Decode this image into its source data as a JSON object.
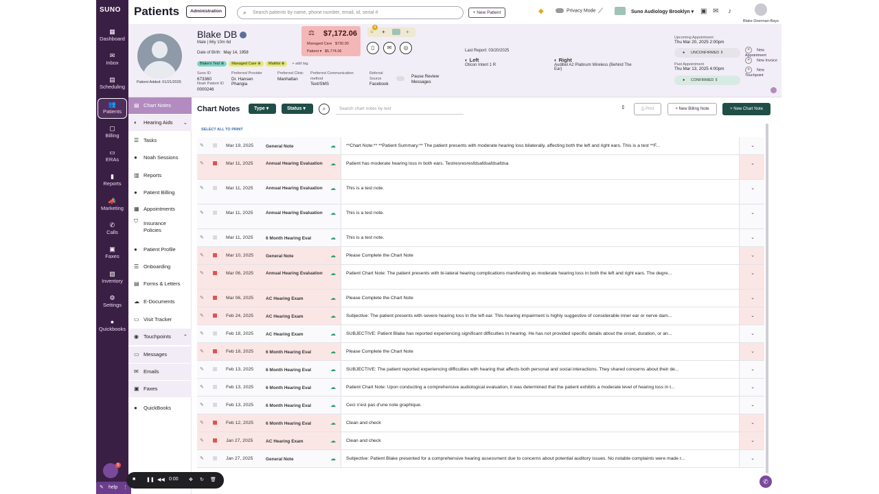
{
  "nav": {
    "brand": "SUNO",
    "items": [
      {
        "icon": "▦",
        "label": "Dashboard"
      },
      {
        "icon": "✉",
        "label": "Inbox"
      },
      {
        "icon": "▤",
        "label": "Scheduling"
      },
      {
        "icon": "👥",
        "label": "Patients"
      },
      {
        "icon": "▢",
        "label": "Billing"
      },
      {
        "icon": "▭",
        "label": "ERAs"
      },
      {
        "icon": "▮",
        "label": "Reports"
      },
      {
        "icon": "📣",
        "label": "Marketing"
      },
      {
        "icon": "✆",
        "label": "Calls"
      },
      {
        "icon": "▣",
        "label": "Faxes"
      },
      {
        "icon": "▧",
        "label": "Inventory"
      },
      {
        "icon": "⚙",
        "label": "Settings"
      },
      {
        "icon": "●",
        "label": "Quickbooks"
      }
    ]
  },
  "topbar": {
    "title": "Patients",
    "admin_label": "Administration",
    "search_placeholder": "Search patients by name, phone number, email, id, serial #",
    "new_patient_label": "+ New Patient",
    "privacy_label": "Privacy Mode",
    "clinic_label": "Suno Audiology Brooklyn",
    "user_name": "Blake Doerman-Bays"
  },
  "patient": {
    "name": "Blake DB",
    "sub": "Male | 66y 10m 6d",
    "dob_label": "Date of Birth:",
    "dob": "May 14, 1958",
    "added": "Patient Added: 01/21/2025",
    "tags": [
      {
        "label": "Blake's Test",
        "color": "#7fd6c4"
      },
      {
        "label": "Managed Care",
        "color": "#e5e86e"
      },
      {
        "label": "Waitlist",
        "color": "#e5e86e"
      }
    ],
    "add_tag": "+ add tag",
    "suno_id_label": "Suno ID",
    "suno_id": "673360",
    "noah_id_label": "Noah Patient ID",
    "noah_id": "0000246",
    "provider_label": "Preferred Provider",
    "provider": "Dr. Hansen Phangia",
    "clinic_label": "Preferred Clinic",
    "clinic": "Manhattan",
    "comm_label": "Preferred Communication method",
    "comm": "Text/SMS",
    "referral_label": "Referral Source",
    "referral": "Facebook",
    "pause_label": "Pause Review Messages",
    "balance_total": "$7,172.06",
    "managed_care_label": "Managed Care",
    "managed_care_amt": "$730.00",
    "patient_label": "Patient",
    "patient_amt": "$5,774.06",
    "quick_badge": "4",
    "last_report": "Last Report: 03/20/2025",
    "left_label": "Left",
    "left_device": "Oticon Intent 1 R",
    "right_label": "Right",
    "right_device": "Audibel A2 Platinum Wireless (Behind The Ear)",
    "upcoming_label": "Upcoming Appointment",
    "upcoming": "Thu Mar 20, 2025 2:00pm",
    "upcoming_status": "UNCONFIRMED",
    "past_label": "Past Appointment",
    "past": "Thu Mar 13, 2025 4:00pm",
    "past_status": "CONFIRMED",
    "new_appt": "New Appointment",
    "new_invoice": "New Invoice",
    "new_touchpoint": "New Touchpoint"
  },
  "subnav": [
    {
      "icon": "▤",
      "label": "Chart Notes",
      "state": "active"
    },
    {
      "icon": "◐",
      "label": "Hearing Aids",
      "state": "grp",
      "chev": "⌄"
    },
    {
      "icon": "☰",
      "label": "Tasks"
    },
    {
      "icon": "●",
      "label": "Noah Sessions"
    },
    {
      "icon": "▥",
      "label": "Reports"
    },
    {
      "icon": "●",
      "label": "Patient Billing"
    },
    {
      "icon": "▦",
      "label": "Appointments"
    },
    {
      "icon": "⛉",
      "label": "Insurance Policies",
      "two": true
    },
    {
      "icon": "●",
      "label": "Patient Profile"
    },
    {
      "icon": "☰",
      "label": "Onboarding"
    },
    {
      "icon": "▤",
      "label": "Forms & Letters"
    },
    {
      "icon": "☁",
      "label": "E-Documents"
    },
    {
      "icon": "▭",
      "label": "Visit Tracker"
    },
    {
      "icon": "◉",
      "label": "Touchpoints",
      "state": "grp",
      "chev": "⌃"
    },
    {
      "icon": "▭",
      "label": "Messages",
      "state": "grp"
    },
    {
      "icon": "✉",
      "label": "Emails",
      "state": "grp"
    },
    {
      "icon": "▣",
      "label": "Faxes",
      "state": "grp"
    },
    {
      "icon": "●",
      "label": "QuickBooks"
    }
  ],
  "chart_notes": {
    "title": "Chart Notes",
    "type_label": "Type",
    "status_label": "Status",
    "search_placeholder": "Search chart notes by text",
    "print_label": "Print",
    "new_billing_label": "+ New Billing Note",
    "new_chart_label": "+ New Chart Note",
    "select_all": "SELECT ALL TO PRINT",
    "rows": [
      {
        "date": "Mar 19, 2025",
        "type": "General Note",
        "flag": false,
        "tall": false,
        "note": "**Chart Note:** **Patient Summary:** The patient presents with moderate hearing loss bilaterally, affecting both the left and right ears. This is a test **F..."
      },
      {
        "date": "Mar 11, 2025",
        "type": "Annual Hearing Evaluation",
        "flag": true,
        "tall": true,
        "note": "Patient has moderate hearing loss in both ears. Testresresresfdsafdsafdsafdsa"
      },
      {
        "date": "Mar 11, 2025",
        "type": "Annual Hearing Evaluation",
        "flag": false,
        "tall": true,
        "note": "This is a test note."
      },
      {
        "date": "Mar 11, 2025",
        "type": "Annual Hearing Evaluation",
        "flag": false,
        "tall": true,
        "note": "This is a test note."
      },
      {
        "date": "Mar 11, 2025",
        "type": "6 Month Hearing Eval",
        "flag": false,
        "tall": false,
        "note": "This is a test note."
      },
      {
        "date": "Mar 10, 2025",
        "type": "General Note",
        "flag": true,
        "tall": false,
        "note": "Please Complete the Chart Note"
      },
      {
        "date": "Mar 06, 2025",
        "type": "Annual Hearing Evaluation",
        "flag": true,
        "tall": true,
        "note": "Patient Chart Note: The patient presents with bi-lateral hearing complications manifesting as moderate hearing loss in both the left and right ears. The degre..."
      },
      {
        "date": "Mar 06, 2025",
        "type": "AC Hearing Exam",
        "flag": true,
        "tall": false,
        "note": "Please Complete the Chart Note"
      },
      {
        "date": "Feb 24, 2025",
        "type": "AC Hearing Exam",
        "flag": true,
        "tall": false,
        "note": "Subjective: The patient presents with severe hearing loss in the left ear. This hearing impairment is highly suggestive of considerable inner ear or nerve dam..."
      },
      {
        "date": "Feb 18, 2025",
        "type": "AC Hearing Exam",
        "flag": false,
        "tall": false,
        "note": "SUBJECTIVE: Patient Blake has reported experiencing significant difficulties in hearing. He has not provided specific details about the onset, duration, or an..."
      },
      {
        "date": "Feb 18, 2025",
        "type": "6 Month Hearing Eval",
        "flag": true,
        "tall": false,
        "note": "Please Complete the Chart Note"
      },
      {
        "date": "Feb 13, 2025",
        "type": "6 Month Hearing Eval",
        "flag": false,
        "tall": false,
        "note": "SUBJECTIVE: The patient reported experiencing difficulties with hearing that affects both personal and social interactions. They shared concerns about their de..."
      },
      {
        "date": "Feb 13, 2025",
        "type": "6 Month Hearing Eval",
        "flag": false,
        "tall": false,
        "note": "Patient Chart Note: Upon conducting a comprehensive audiological evaluation, it was determined that the patient exhibits a moderate level of hearing loss in t..."
      },
      {
        "date": "Feb 13, 2025",
        "type": "6 Month Hearing Eval",
        "flag": false,
        "tall": false,
        "note": "Ceci n'est pas d'une note graphique."
      },
      {
        "date": "Feb 12, 2025",
        "type": "6 Month Hearing Eval",
        "flag": true,
        "tall": false,
        "note": "Clean and check"
      },
      {
        "date": "Jan 27, 2025",
        "type": "AC Hearing Exam",
        "flag": true,
        "tall": false,
        "note": "Clean and check"
      },
      {
        "date": "Jan 27, 2025",
        "type": "General Note",
        "flag": false,
        "tall": false,
        "note": "Subjective:  Patient Blake presented for a comprehensive hearing assessment due to concerns about potential auditory issues. No notable complaints were made r..."
      }
    ]
  },
  "recorder": {
    "time": "0:00"
  },
  "help_label": "help",
  "chat_badge": "5"
}
